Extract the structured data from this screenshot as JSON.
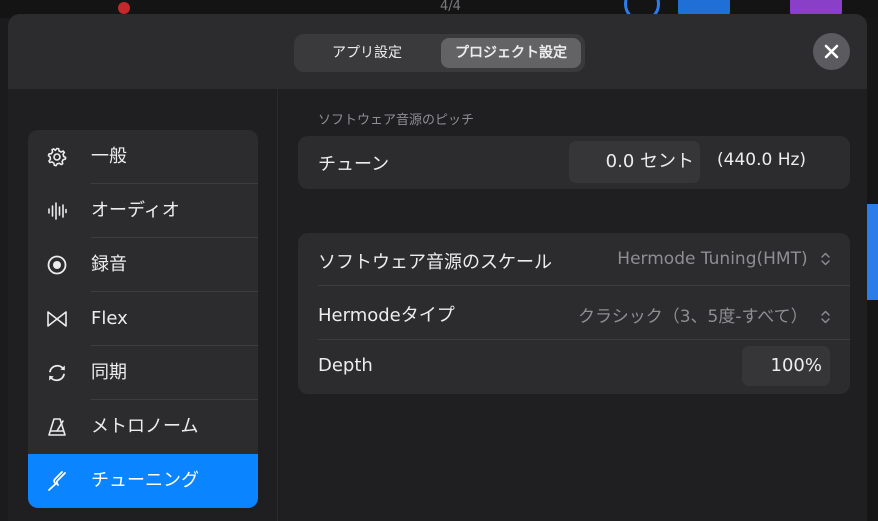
{
  "background": {
    "time_signature": "4/4"
  },
  "header": {
    "tabs": [
      {
        "label": "アプリ設定",
        "selected": false
      },
      {
        "label": "プロジェクト設定",
        "selected": true
      }
    ],
    "close_icon": "close-icon"
  },
  "sidebar": {
    "items": [
      {
        "label": "一般",
        "icon": "gear-icon",
        "selected": false
      },
      {
        "label": "オーディオ",
        "icon": "waveform-icon",
        "selected": false
      },
      {
        "label": "録音",
        "icon": "record-icon",
        "selected": false
      },
      {
        "label": "Flex",
        "icon": "flex-icon",
        "selected": false
      },
      {
        "label": "同期",
        "icon": "sync-icon",
        "selected": false
      },
      {
        "label": "メトロノーム",
        "icon": "metronome-icon",
        "selected": false
      },
      {
        "label": "チューニング",
        "icon": "tuning-fork-icon",
        "selected": true
      }
    ]
  },
  "main": {
    "pitch_section_title": "ソフトウェア音源のピッチ",
    "tune": {
      "label": "チューン",
      "value": "0.0 セント",
      "hz": "(440.0 Hz)"
    },
    "scale": {
      "label": "ソフトウェア音源のスケール",
      "value": "Hermode Tuning(HMT)"
    },
    "hermode_type": {
      "label": "Hermodeタイプ",
      "value": "クラシック（3、5度-すべて）"
    },
    "depth": {
      "label": "Depth",
      "value": "100%"
    }
  },
  "colors": {
    "accent": "#0a84ff",
    "panel": "#2c2c2e",
    "background": "#1f1f21"
  }
}
